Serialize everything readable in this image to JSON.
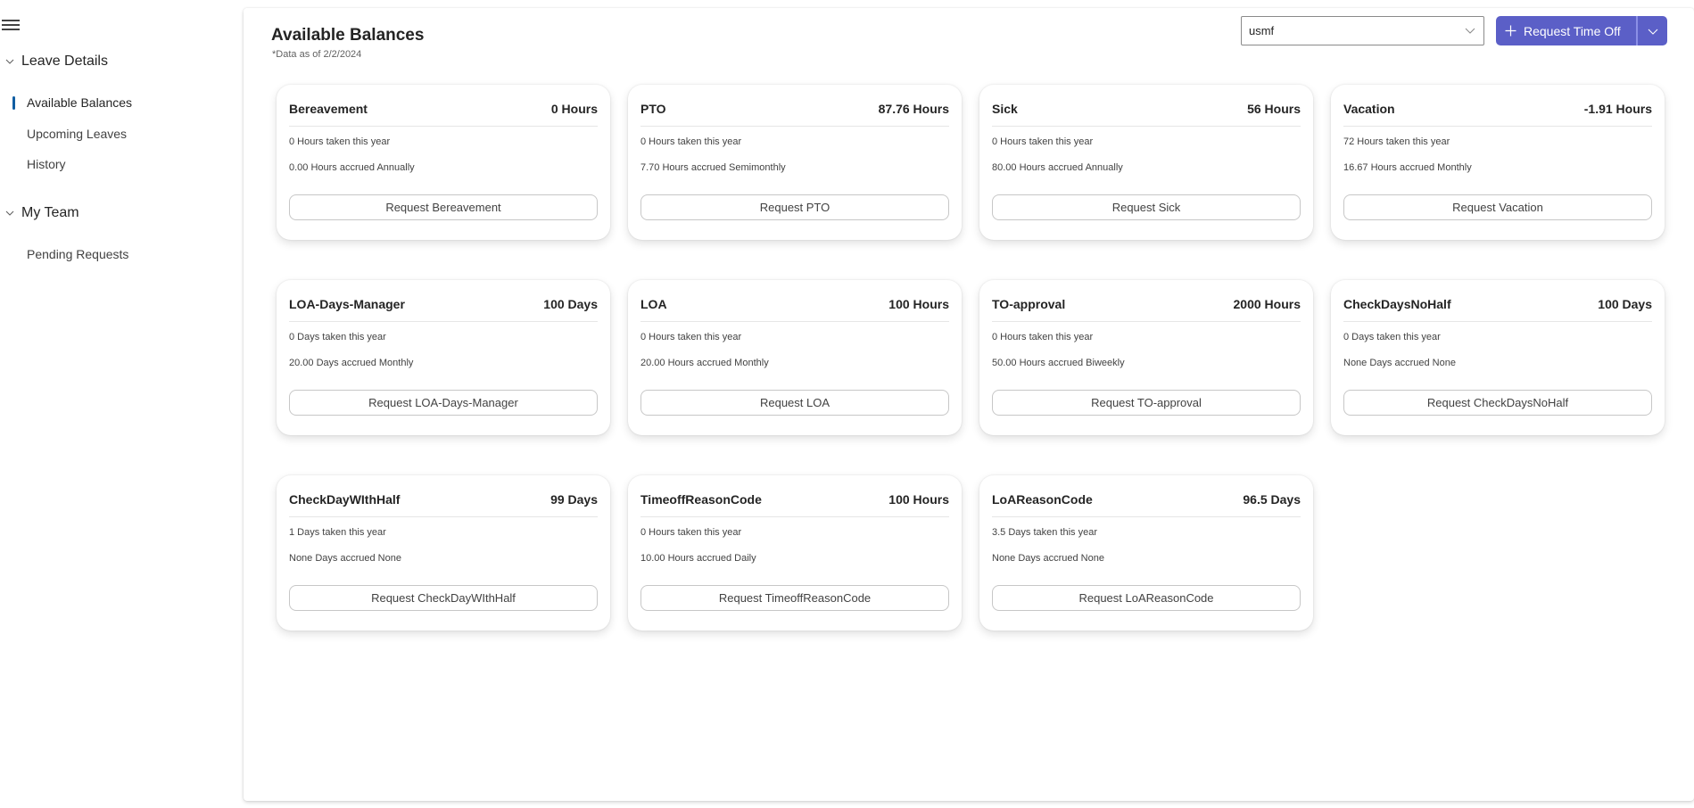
{
  "sidebar": {
    "menu_icon": "hamburger-menu-icon",
    "groups": [
      {
        "label": "Leave Details",
        "expanded": true,
        "items": [
          {
            "label": "Available Balances",
            "active": true
          },
          {
            "label": "Upcoming Leaves",
            "active": false
          },
          {
            "label": "History",
            "active": false
          }
        ]
      },
      {
        "label": "My Team",
        "expanded": true,
        "items": [
          {
            "label": "Pending Requests",
            "active": false
          }
        ]
      }
    ]
  },
  "header": {
    "title": "Available Balances",
    "subtitle": "*Data as of 2/2/2024",
    "company_select": {
      "value": "usmf"
    },
    "request_button": {
      "label": "Request Time Off",
      "icon": "plus-icon",
      "dropdown_icon": "chevron-down-icon"
    }
  },
  "colors": {
    "accent": "#5b5fc7",
    "nav_indicator": "#115ea3"
  },
  "cards": [
    {
      "title": "Bereavement",
      "balance": "0 Hours",
      "taken": "0 Hours taken this year",
      "accrued": "0.00 Hours accrued Annually",
      "button": "Request Bereavement"
    },
    {
      "title": "PTO",
      "balance": "87.76 Hours",
      "taken": "0 Hours taken this year",
      "accrued": "7.70 Hours accrued Semimonthly",
      "button": "Request PTO"
    },
    {
      "title": "Sick",
      "balance": "56 Hours",
      "taken": "0 Hours taken this year",
      "accrued": "80.00 Hours accrued Annually",
      "button": "Request Sick"
    },
    {
      "title": "Vacation",
      "balance": "-1.91 Hours",
      "taken": "72 Hours taken this year",
      "accrued": "16.67 Hours accrued Monthly",
      "button": "Request Vacation"
    },
    {
      "title": "LOA-Days-Manager",
      "balance": "100 Days",
      "taken": "0 Days taken this year",
      "accrued": "20.00 Days accrued Monthly",
      "button": "Request LOA-Days-Manager"
    },
    {
      "title": "LOA",
      "balance": "100 Hours",
      "taken": "0 Hours taken this year",
      "accrued": "20.00 Hours accrued Monthly",
      "button": "Request LOA"
    },
    {
      "title": "TO-approval",
      "balance": "2000 Hours",
      "taken": "0 Hours taken this year",
      "accrued": "50.00 Hours accrued Biweekly",
      "button": "Request TO-approval"
    },
    {
      "title": "CheckDaysNoHalf",
      "balance": "100 Days",
      "taken": "0 Days taken this year",
      "accrued": "None Days accrued None",
      "button": "Request CheckDaysNoHalf"
    },
    {
      "title": "CheckDayWIthHalf",
      "balance": "99 Days",
      "taken": "1 Days taken this year",
      "accrued": "None Days accrued None",
      "button": "Request CheckDayWIthHalf"
    },
    {
      "title": "TimeoffReasonCode",
      "balance": "100 Hours",
      "taken": "0 Hours taken this year",
      "accrued": "10.00 Hours accrued Daily",
      "button": "Request TimeoffReasonCode"
    },
    {
      "title": "LoAReasonCode",
      "balance": "96.5 Days",
      "taken": "3.5 Days taken this year",
      "accrued": "None Days accrued None",
      "button": "Request LoAReasonCode"
    }
  ]
}
